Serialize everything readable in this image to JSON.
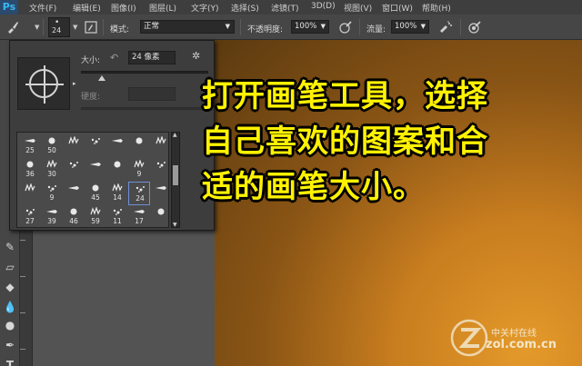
{
  "app": {
    "logo": "Ps"
  },
  "menubar": {
    "items": [
      "文件(F)",
      "编辑(E)",
      "图像(I)",
      "图层(L)",
      "文字(Y)",
      "选择(S)",
      "滤镜(T)",
      "3D(D)",
      "视图(V)",
      "窗口(W)",
      "帮助(H)"
    ]
  },
  "options": {
    "brush_size": "24",
    "mode_label": "模式:",
    "mode_value": "正常",
    "opacity_label": "不透明度:",
    "opacity_value": "100%",
    "flow_label": "流量:",
    "flow_value": "100%",
    "icons": [
      "brush-tool-icon",
      "brush-panel-toggle-icon",
      "pressure-opacity-icon",
      "airbrush-icon",
      "pressure-size-icon"
    ]
  },
  "brush_panel": {
    "size_label": "大小:",
    "size_value": "24 像素",
    "hardness_label": "硬度:",
    "size_slider_fraction": 0.16,
    "presets": [
      [
        "25",
        "50",
        "",
        "",
        "",
        "",
        ""
      ],
      [
        "36",
        "30",
        "",
        "",
        "",
        "9",
        ""
      ],
      [
        "",
        "9",
        "",
        "45",
        "14",
        "24",
        ""
      ],
      [
        "27",
        "39",
        "46",
        "59",
        "11",
        "17",
        ""
      ]
    ],
    "selected_preset": "24",
    "scroll_position_fraction": 0.4
  },
  "overlay": {
    "lines": [
      "打开画笔工具，选择",
      "自己喜欢的图案和合",
      "适的画笔大小。"
    ],
    "color": "#fff200"
  },
  "watermark": {
    "cn": "中关村在线",
    "en": "zol.com.cn"
  }
}
